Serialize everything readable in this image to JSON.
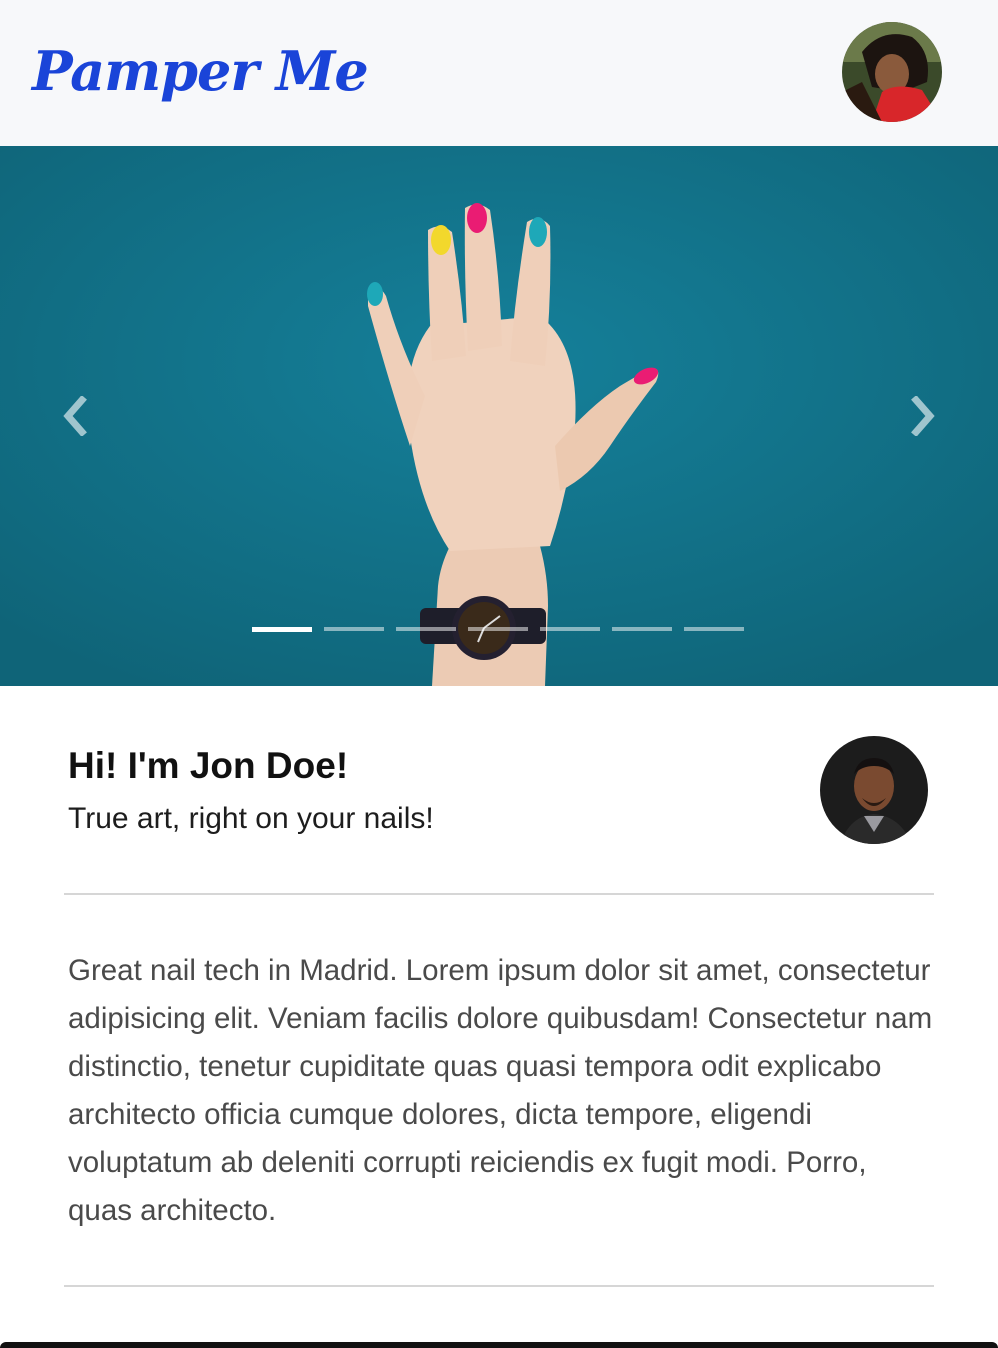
{
  "header": {
    "brand": "Pamper Me",
    "user_avatar_alt": "User profile"
  },
  "carousel": {
    "slide_count": 7,
    "active_index": 0,
    "prev_label": "Previous",
    "next_label": "Next"
  },
  "profile": {
    "name": "Hi! I'm Jon Doe!",
    "tagline": "True art, right on your nails!",
    "bio": "Great nail tech in Madrid. Lorem ipsum dolor sit amet, consectetur adipisicing elit. Veniam facilis dolore quibusdam! Consectetur nam distinctio, tenetur cupiditate quas quasi tempora odit explicabo architecto officia cumque dolores, dicta tempore, eligendi voluptatum ab deleniti corrupti reiciendis ex fugit modi. Porro, quas architecto."
  },
  "colors": {
    "brand": "#1a44d8",
    "carousel_bg": "#127389",
    "header_bg": "#f7f8fa"
  }
}
